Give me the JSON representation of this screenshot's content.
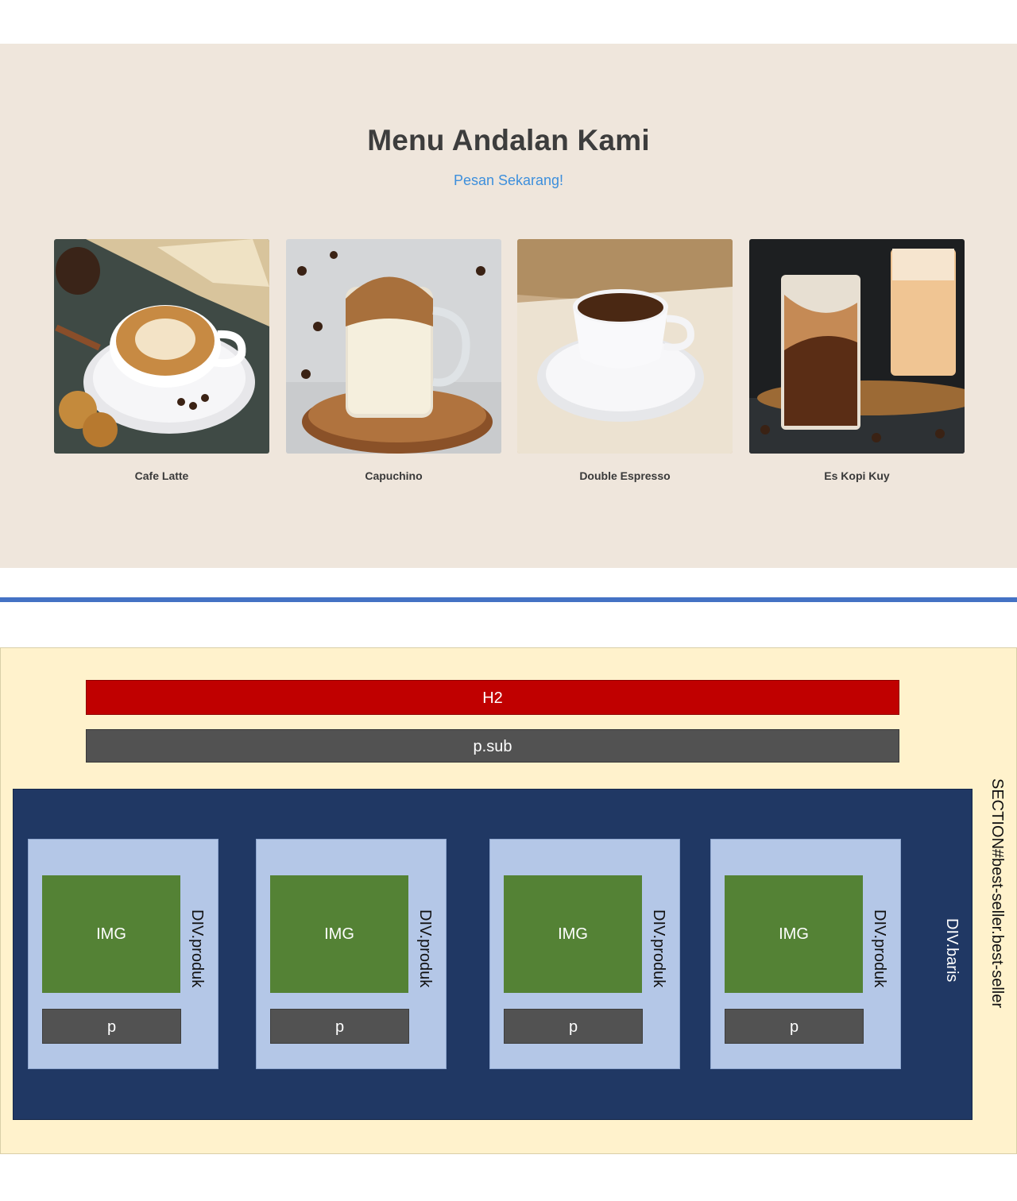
{
  "rendered": {
    "title": "Menu Andalan Kami",
    "subtitle": "Pesan Sekarang!",
    "products": [
      {
        "name": "Cafe Latte",
        "image": "cafe-latte-photo"
      },
      {
        "name": "Capuchino",
        "image": "capuchino-photo"
      },
      {
        "name": "Double Espresso",
        "image": "double-espresso-photo"
      },
      {
        "name": "Es Kopi Kuy",
        "image": "es-kopi-kuy-photo"
      }
    ]
  },
  "diagram": {
    "section_label": "SECTION#best-seller.best-seller",
    "h2_label": "H2",
    "psub_label": "p.sub",
    "baris_label": "DIV.baris",
    "produk": [
      {
        "label": "DIV.produk",
        "img": "IMG",
        "p": "p"
      },
      {
        "label": "DIV.produk",
        "img": "IMG",
        "p": "p"
      },
      {
        "label": "DIV.produk",
        "img": "IMG",
        "p": "p"
      },
      {
        "label": "DIV.produk",
        "img": "IMG",
        "p": "p"
      }
    ]
  },
  "colors": {
    "section_bg": "#efe6dc",
    "subtitle": "#3d8fdc",
    "divider": "#4472c4",
    "diagram_section": "#fff2cc",
    "h2_block": "#c00000",
    "text_block": "#525252",
    "baris_block": "#203864",
    "produk_block": "#b4c7e7",
    "img_block": "#548235"
  }
}
